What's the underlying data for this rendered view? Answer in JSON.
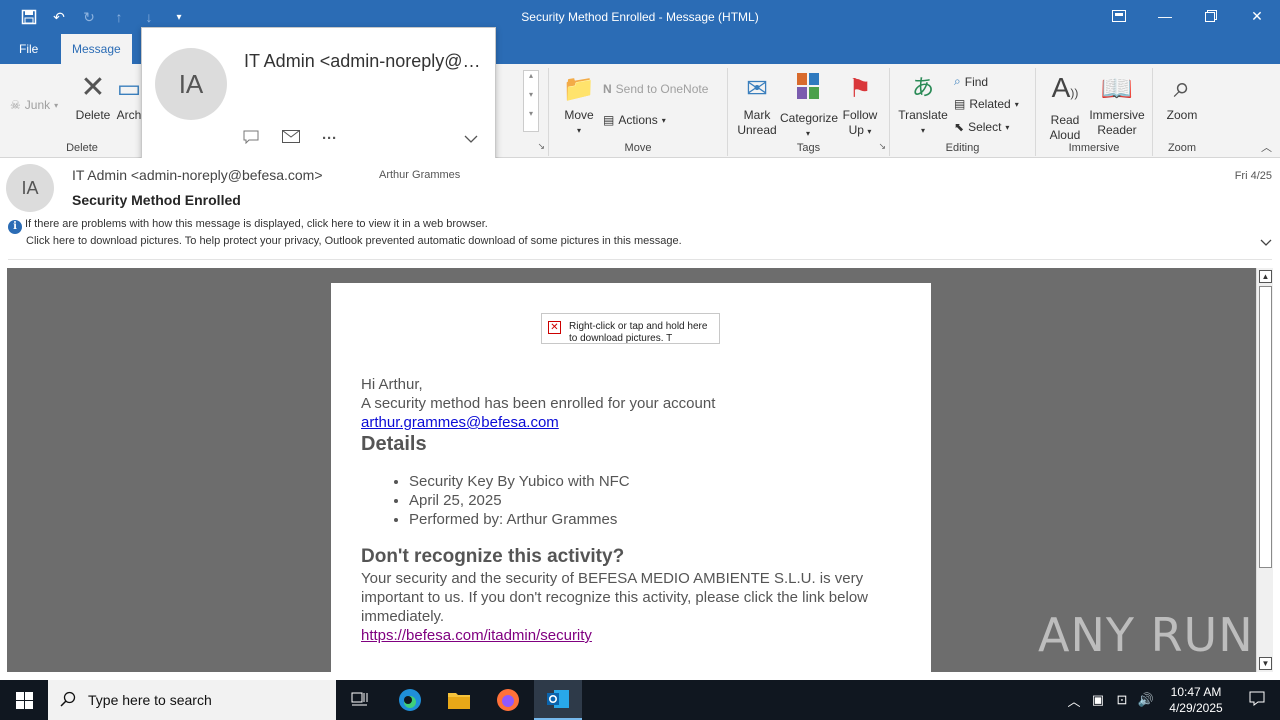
{
  "window": {
    "title": "Security Method Enrolled  -  Message (HTML)"
  },
  "ribbon_tabs": [
    "File",
    "Message"
  ],
  "ribbon": {
    "junk": "Junk",
    "delete": "Delete",
    "archive": "Arch",
    "delete_group": "Delete",
    "send_to_onenote": "Send to OneNote",
    "move": "Move",
    "actions": "Actions",
    "move_group": "Move",
    "mark_unread_1": "Mark",
    "mark_unread_2": "Unread",
    "categorize": "Categorize",
    "follow_up_1": "Follow",
    "follow_up_2": "Up",
    "tags_group": "Tags",
    "translate": "Translate",
    "find": "Find",
    "related": "Related",
    "select": "Select",
    "editing_group": "Editing",
    "read_aloud_1": "Read",
    "read_aloud_2": "Aloud",
    "immersive_reader_1": "Immersive",
    "immersive_reader_2": "Reader",
    "immersive_group": "Immersive",
    "zoom": "Zoom",
    "zoom_group": "Zoom"
  },
  "contact_card": {
    "initials": "IA",
    "name": "IT Admin <admin-noreply@befesa.com>"
  },
  "header": {
    "initials": "IA",
    "sender": "IT Admin <admin-noreply@befesa.com>",
    "recipient": "Arthur Grammes",
    "date": "Fri 4/25",
    "subject": "Security Method Enrolled",
    "info_line1": "If there are problems with how this message is displayed, click here to view it in a web browser.",
    "info_line2": "Click here to download pictures. To help protect your privacy, Outlook prevented automatic download of some pictures in this message."
  },
  "email": {
    "image_placeholder": "Right-click or tap and hold here to download pictures. T",
    "greeting": "Hi Arthur,",
    "intro": "A security method has been enrolled for your account",
    "account_link": "arthur.grammes@befesa.com",
    "details_heading": "Details",
    "details": [
      "Security Key By Yubico with NFC",
      "April 25, 2025",
      "Performed by:  Arthur Grammes"
    ],
    "warning_heading": "Don't recognize this activity?",
    "warning_text": "Your security and the security of BEFESA MEDIO AMBIENTE S.L.U. is very important to us. If you don't recognize this activity, please click the link below immediately.",
    "security_link": "https://befesa.com/itadmin/security"
  },
  "watermark": "ANY RUN",
  "taskbar": {
    "search_placeholder": "Type here to search",
    "time": "10:47 AM",
    "date": "4/29/2025"
  },
  "colors": {
    "titlebar": "#2b6cb5",
    "ribbon": "#f3f3f3",
    "viewer_bg": "#6d6d6d",
    "link": "#0b0bd6",
    "visited_link": "#800080",
    "taskbar": "#101720"
  }
}
